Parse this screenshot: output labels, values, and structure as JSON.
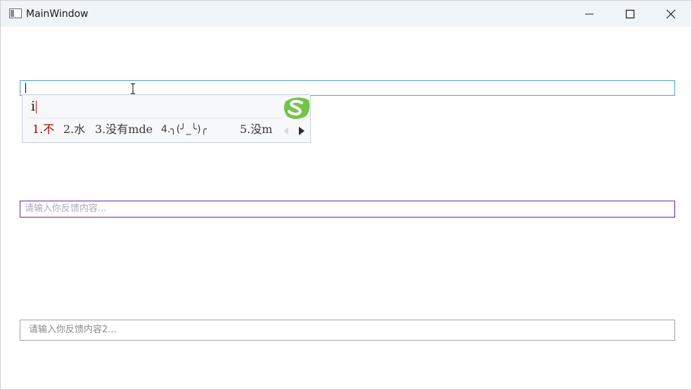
{
  "window": {
    "title": "MainWindow"
  },
  "textbox1": {
    "value": ""
  },
  "ime": {
    "composition": "i",
    "candidates": [
      {
        "label": "1.不",
        "selected": true
      },
      {
        "label": "2.水",
        "selected": false
      },
      {
        "label": "3.没有mde",
        "selected": false
      },
      {
        "label": "4.╮(╯_╰)╭",
        "selected": false
      },
      {
        "label": "5.没m",
        "selected": false
      }
    ],
    "logo_icon": "sogou-logo-icon"
  },
  "textbox2": {
    "placeholder": "请输入你反馈内容..."
  },
  "textbox3": {
    "placeholder": "请输入你反馈内容2..."
  },
  "colors": {
    "titlebar": "#eff4f9",
    "focus_border": "#4a9fd8",
    "textbox2_border": "#6a1fb0",
    "textbox3_border": "#a6a6a6",
    "candidate_selected": "#b00000"
  }
}
